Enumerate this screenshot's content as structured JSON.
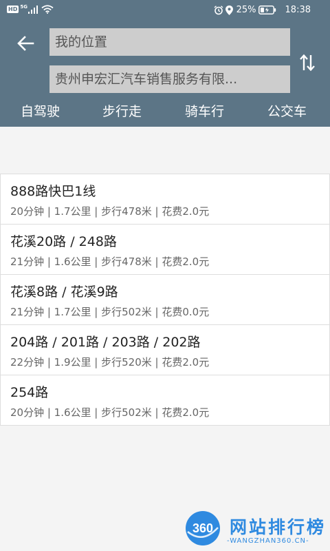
{
  "status_bar": {
    "hd": "HD",
    "network": "5G",
    "battery_percent": "25%",
    "time": "18:38"
  },
  "search": {
    "from": "我的位置",
    "to": "贵州申宏汇汽车销售服务有限..."
  },
  "modes": [
    {
      "label": "自驾驶"
    },
    {
      "label": "步行走"
    },
    {
      "label": "骑车行"
    },
    {
      "label": "公交车"
    }
  ],
  "routes": [
    {
      "name": "888路快巴1线",
      "meta": "20分钟 | 1.7公里 | 步行478米 | 花费2.0元"
    },
    {
      "name": "花溪20路 / 248路",
      "meta": "21分钟 | 1.6公里 | 步行478米 | 花费2.0元"
    },
    {
      "name": "花溪8路 / 花溪9路",
      "meta": "21分钟 | 1.7公里 | 步行502米 | 花费0.0元"
    },
    {
      "name": "204路 / 201路 / 203路 / 202路",
      "meta": "22分钟 | 1.9公里 | 步行520米 | 花费2.0元"
    },
    {
      "name": "254路",
      "meta": "20分钟 | 1.6公里 | 步行502米 | 花费2.0元"
    }
  ],
  "watermark": {
    "logo_text": "360",
    "title": "网站排行榜",
    "subtitle": "-WANGZHAN360.CN-"
  },
  "colors": {
    "header": "#5c7586",
    "field": "#cdcdcd",
    "watermark": "#2f8ae0"
  }
}
